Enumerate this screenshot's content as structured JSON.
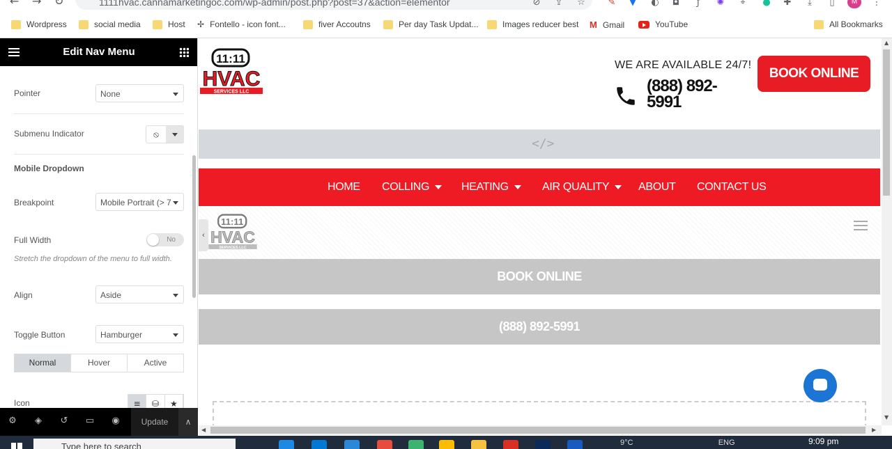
{
  "browser": {
    "url": "1111hvac.cannamarketingoc.com/wp-admin/post.php?post=37&action=elementor",
    "bookmarks": [
      "Wordpress",
      "social media",
      "Host",
      "Fontello - icon font...",
      "fiver Accoutns",
      "Per day Task Updat...",
      "Images reducer best",
      "Gmail",
      "YouTube"
    ],
    "all_bookmarks": "All Bookmarks",
    "profile_initial": "M"
  },
  "panel": {
    "title": "Edit Nav Menu",
    "controls": {
      "pointer_label": "Pointer",
      "pointer_value": "None",
      "submenu_indicator_label": "Submenu Indicator",
      "section_title": "Mobile Dropdown",
      "breakpoint_label": "Breakpoint",
      "breakpoint_value": "Mobile Portrait (> 7",
      "full_width_label": "Full Width",
      "full_width_value": "No",
      "full_width_hint": "Stretch the dropdown of the menu to full width.",
      "align_label": "Align",
      "align_value": "Aside",
      "toggle_button_label": "Toggle Button",
      "toggle_button_value": "Hamburger",
      "icon_label": "Icon"
    },
    "state_tabs": [
      "Normal",
      "Hover",
      "Active"
    ],
    "update_label": "Update"
  },
  "site": {
    "logo_text_top": "11:11",
    "logo_text_main": "HVAC",
    "logo_text_sub": "SERVICES LLC",
    "available": "WE ARE AVAILABLE 24/7!",
    "phone": "(888) 892-5991",
    "book_online": "BOOK ONLINE",
    "nav": [
      {
        "label": "HOME",
        "dropdown": false
      },
      {
        "label": "COLLING",
        "dropdown": true
      },
      {
        "label": "HEATING",
        "dropdown": true
      },
      {
        "label": "AIR QUALITY",
        "dropdown": true
      },
      {
        "label": "ABOUT",
        "dropdown": false
      },
      {
        "label": "CONTACT US",
        "dropdown": false
      }
    ],
    "mobile_book_online": "BOOK ONLINE",
    "mobile_phone": "(888) 892-5991"
  },
  "taskbar": {
    "search_placeholder": "Type here to search",
    "time": "9:09 pm",
    "lang": "ENG",
    "temp": "9°C"
  },
  "colors": {
    "brand_red": "#ee1b24",
    "panel_black": "#000000",
    "chat_blue": "#1c74d4"
  }
}
